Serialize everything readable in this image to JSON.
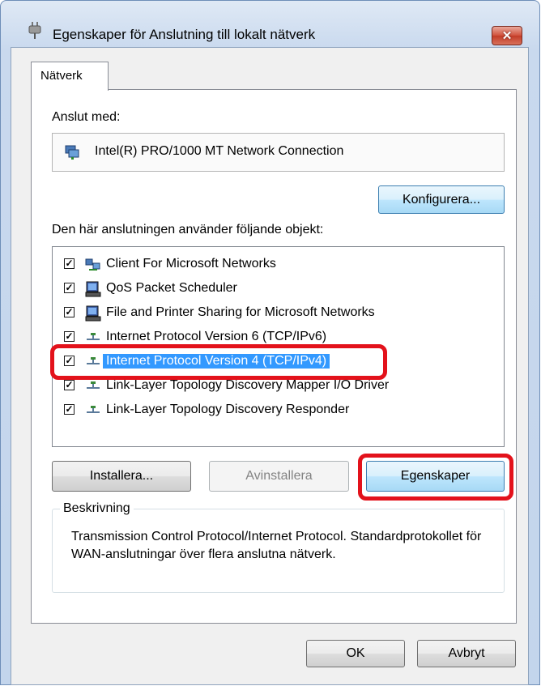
{
  "window": {
    "title": "Egenskaper för Anslutning till lokalt nätverk",
    "close_label": "✕"
  },
  "tabs": [
    {
      "label": "Nätverk",
      "selected": true
    }
  ],
  "connect_using": {
    "label": "Anslut med:",
    "adapter": "Intel(R) PRO/1000 MT Network Connection",
    "configure_button": "Konfigurera..."
  },
  "components": {
    "label": "Den här anslutningen använder följande objekt:",
    "items": [
      {
        "label": "Client For Microsoft Networks",
        "checked": true,
        "icon": "network-client-icon"
      },
      {
        "label": "QoS Packet Scheduler",
        "checked": true,
        "icon": "computer-service-icon"
      },
      {
        "label": "File and Printer Sharing for Microsoft Networks",
        "checked": true,
        "icon": "computer-service-icon"
      },
      {
        "label": "Internet Protocol Version 6 (TCP/IPv6)",
        "checked": true,
        "icon": "protocol-icon"
      },
      {
        "label": "Internet Protocol Version 4 (TCP/IPv4)",
        "checked": true,
        "icon": "protocol-icon",
        "selected": true
      },
      {
        "label": "Link-Layer Topology Discovery Mapper I/O Driver",
        "checked": true,
        "icon": "protocol-icon"
      },
      {
        "label": "Link-Layer Topology Discovery Responder",
        "checked": true,
        "icon": "protocol-icon"
      }
    ]
  },
  "actions": {
    "install": "Installera...",
    "uninstall": "Avinstallera",
    "properties": "Egenskaper"
  },
  "description": {
    "title": "Beskrivning",
    "text": "Transmission Control Protocol/Internet Protocol. Standardprotokollet för WAN-anslutningar över flera anslutna nätverk."
  },
  "footer": {
    "ok": "OK",
    "cancel": "Avbryt"
  },
  "colors": {
    "highlight": "#e3121b",
    "selection": "#3399ff"
  }
}
